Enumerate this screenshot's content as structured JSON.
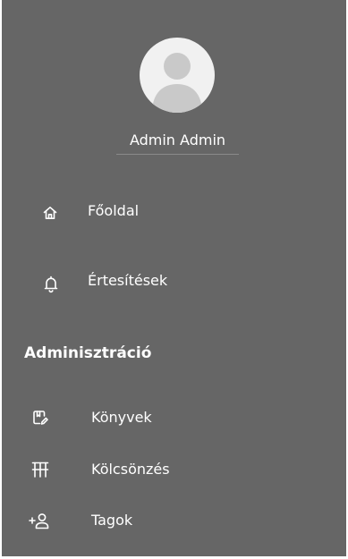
{
  "user": {
    "name": "Admin Admin"
  },
  "nav": {
    "home_label": "Főoldal",
    "notifications_label": "Értesítések"
  },
  "admin": {
    "section_title": "Adminisztráció",
    "books_label": "Könyvek",
    "loans_label": "Kölcsönzés",
    "members_label": "Tagok"
  },
  "icons": {
    "home": "home-icon",
    "notifications": "bell-icon",
    "books": "book-edit-icon",
    "loans": "columns-icon",
    "members": "add-person-icon"
  },
  "colors": {
    "sidebar_background": "#666666",
    "text": "#ffffff",
    "avatar_background": "#f1f1f1",
    "avatar_silhouette": "#c9c9c9"
  }
}
